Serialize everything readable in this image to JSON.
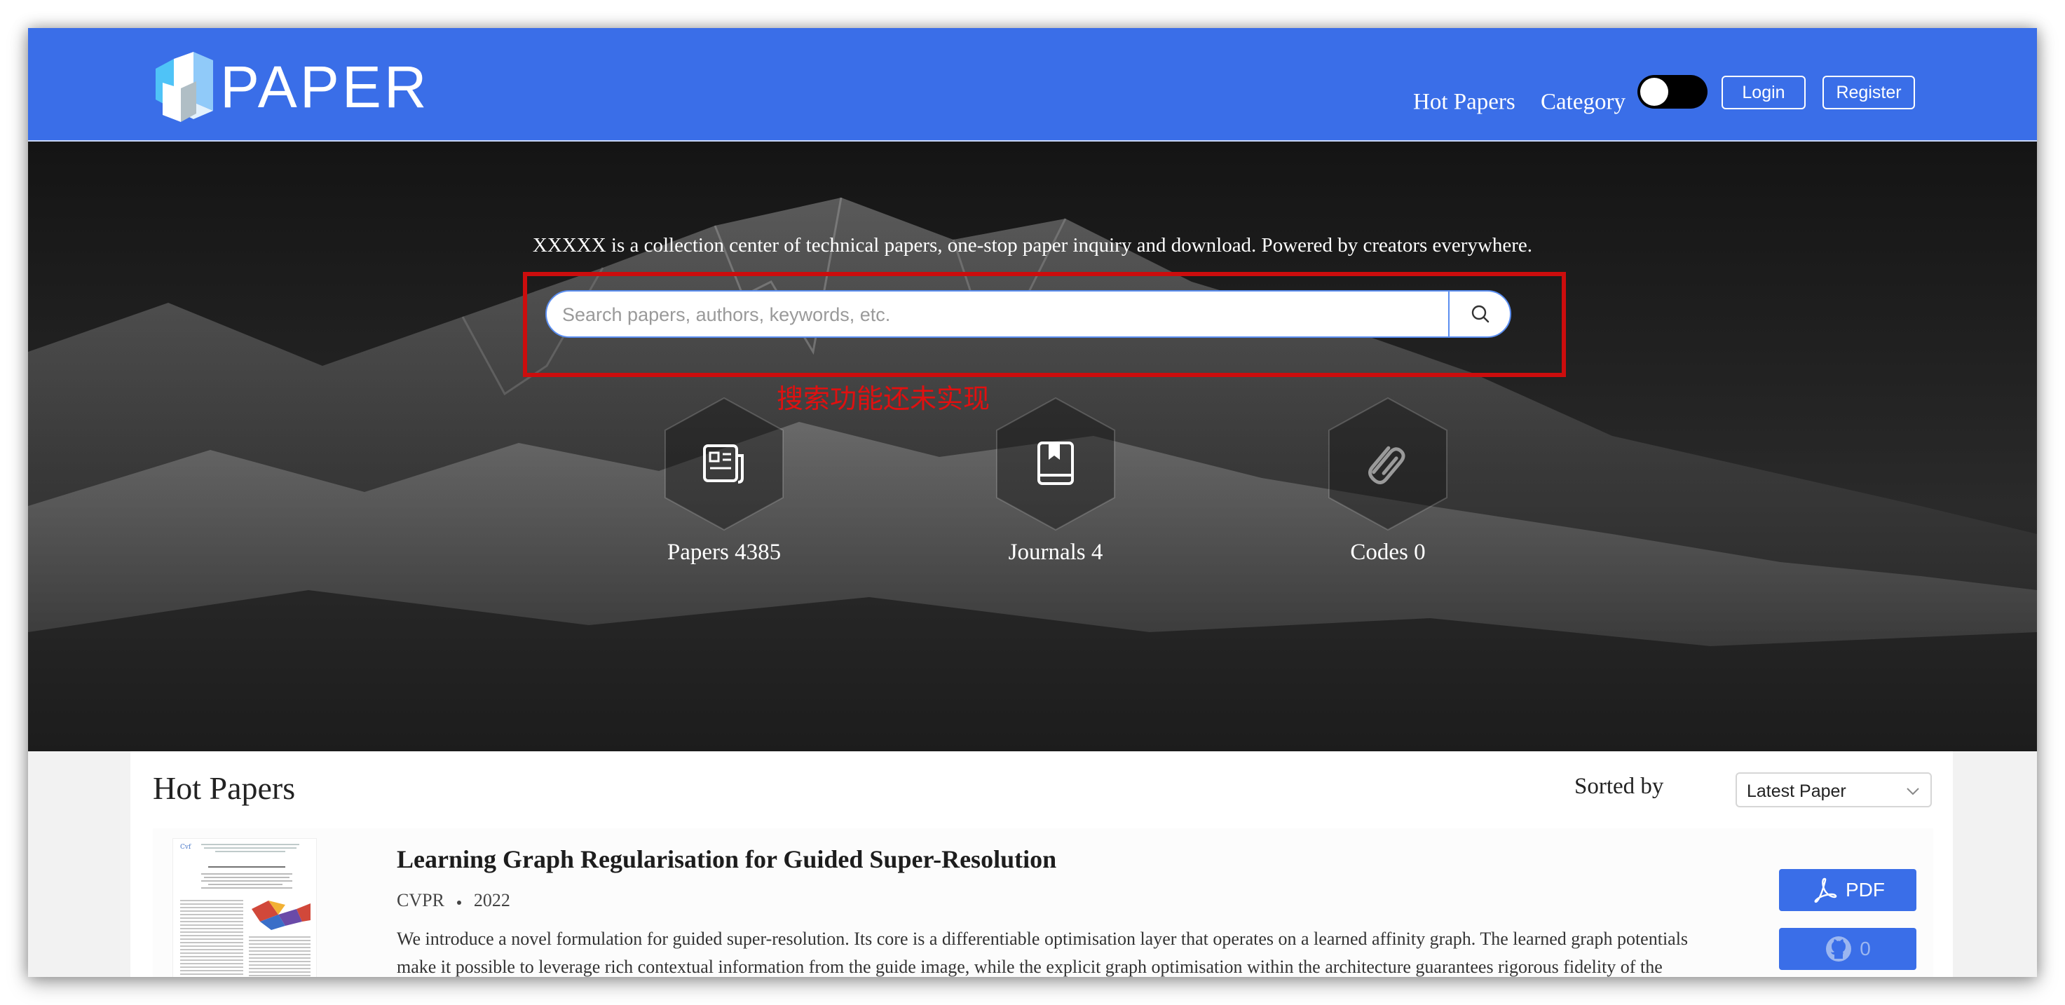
{
  "header": {
    "logo_text": "PAPER",
    "nav": {
      "hot_papers": "Hot Papers",
      "category": "Category"
    },
    "theme_toggle": {
      "on": false
    },
    "login_label": "Login",
    "register_label": "Register"
  },
  "hero": {
    "tagline": "XXXXX is a collection center of technical papers, one-stop paper inquiry and download. Powered by creators everywhere.",
    "search": {
      "placeholder": "Search papers, authors, keywords, etc.",
      "value": ""
    },
    "annotation_note": "搜索功能还未实现",
    "stats": [
      {
        "label": "Papers 4385",
        "icon": "newspaper-icon"
      },
      {
        "label": "Journals 4",
        "icon": "book-icon"
      },
      {
        "label": "Codes 0",
        "icon": "paperclip-icon"
      }
    ]
  },
  "hot_papers": {
    "title": "Hot Papers",
    "sort_label": "Sorted by",
    "sort_value": "Latest Paper",
    "papers": [
      {
        "title": "Learning Graph Regularisation for Guided Super-Resolution",
        "venue": "CVPR",
        "year": "2022",
        "abstract": "We introduce a novel formulation for guided super-resolution. Its core is a differentiable optimisation layer that operates on a learned affinity graph. The learned graph potentials make it possible to leverage rich contextual information from the guide image, while the explicit graph optimisation within the architecture guarantees rigorous fidelity of the high-resolution target to the low-resolution source. With the decision to employ the source as a constraint rather than only as an input to the…",
        "pdf_label": "PDF",
        "github_count": "0"
      }
    ]
  },
  "colors": {
    "brand_blue": "#3a6ee8",
    "annotation_red": "#cc0d0d"
  }
}
